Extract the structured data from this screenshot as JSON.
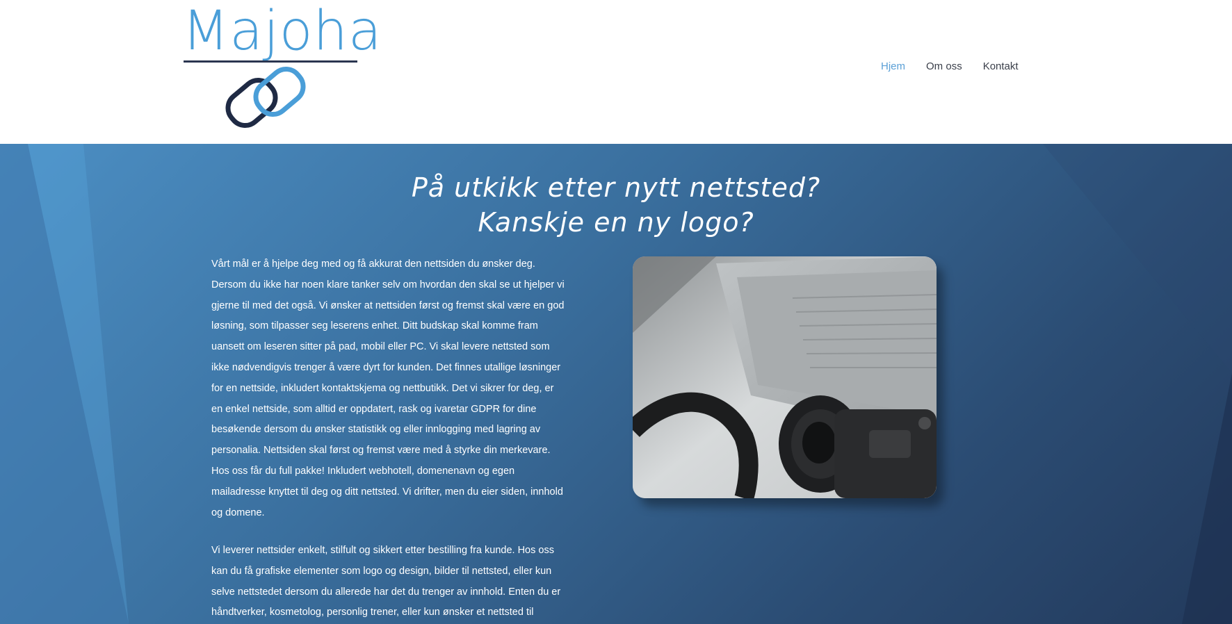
{
  "brand": {
    "name": "Majoha",
    "color": "#4a9ed8",
    "dark": "#1f2a44"
  },
  "nav": {
    "items": [
      {
        "label": "Hjem",
        "active": true
      },
      {
        "label": "Om oss",
        "active": false
      },
      {
        "label": "Kontakt",
        "active": false
      }
    ],
    "active_color": "#5a9fd6"
  },
  "hero": {
    "title_line1": "På utkikk etter nytt nettsted?",
    "title_line2": "Kanskje en ny logo?",
    "paragraph1": "Vårt mål er å hjelpe deg med og få akkurat den nettsiden du ønsker deg. Dersom du ikke har noen klare tanker selv om hvordan den skal se ut hjelper vi gjerne til med det også. Vi ønsker at nettsiden først og fremst skal være en god løsning, som tilpasser seg leserens enhet. Ditt budskap skal komme fram uansett om leseren sitter på pad, mobil eller PC. Vi skal levere nettsted som ikke nødvendigvis trenger å være dyrt for kunden. Det finnes utallige løsninger for en nettside, inkludert kontaktskjema og nettbutikk. Det vi sikrer for deg, er en enkel nettside, som alltid er oppdatert, rask og ivaretar GDPR for dine besøkende dersom du ønsker statistikk og eller innlogging med lagring av personalia. Nettsiden skal først og fremst være med å styrke din merkevare. Hos oss får du full pakke! Inkludert webhotell, domenenavn og egen mailadresse knyttet til deg og ditt nettsted. Vi drifter, men du eier siden, innhold og domene.",
    "paragraph2": "Vi leverer nettsider enkelt, stilfult og sikkert etter bestilling fra kunde. Hos oss kan du få grafiske elementer som logo og design, bilder til nettsted, eller kun selve nettstedet dersom du allerede har det du trenger av innhold. Enten du er håndtverker, kosmetolog, personlig trener, eller kun ønsker et nettsted til",
    "gradient_start": "#4c8fc4",
    "gradient_end": "#233a5c"
  },
  "photo": {
    "subject": "camera-and-laptop-photo"
  }
}
